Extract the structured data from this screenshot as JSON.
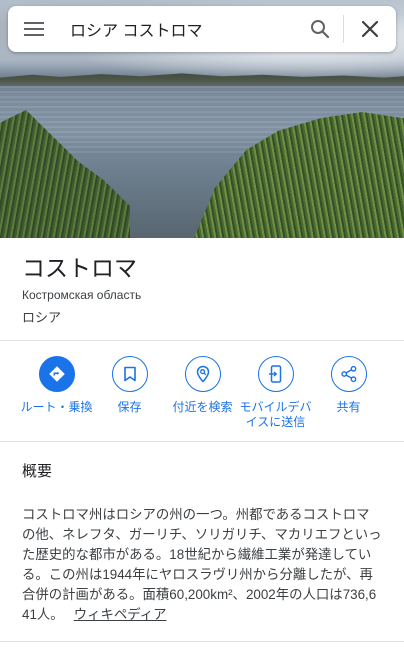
{
  "search": {
    "query": "ロシア コストロマ",
    "menu_icon": "hamburger-menu-icon",
    "search_icon": "search-icon",
    "close_icon": "close-icon"
  },
  "place": {
    "title": "コストロマ",
    "subtitle": "Костромская область",
    "country": "ロシア"
  },
  "actions": [
    {
      "label": "ルート・乗換",
      "icon": "directions-icon"
    },
    {
      "label": "保存",
      "icon": "bookmark-icon"
    },
    {
      "label": "付近を検索",
      "icon": "nearby-search-icon"
    },
    {
      "label_line1": "モバイルデバ",
      "label_line2": "イスに送信",
      "icon": "send-to-phone-icon"
    },
    {
      "label": "共有",
      "icon": "share-icon"
    }
  ],
  "overview": {
    "heading": "概要",
    "text": "コストロマ州はロシアの州の一つ。州都であるコストロマの他、ネレフタ、ガーリチ、ソリガリチ、マカリエフといった歴史的な都市がある。18世紀から繊維工業が発達している。この州は1944年にヤロスラヴリ州から分離したが、再合併の計画がある。面積60,200km²、2002年の人口は736,641人。",
    "link": "ウィキペディア"
  },
  "colors": {
    "accent": "#1a73e8",
    "text_primary": "#202124",
    "text_secondary": "#3c4043"
  }
}
